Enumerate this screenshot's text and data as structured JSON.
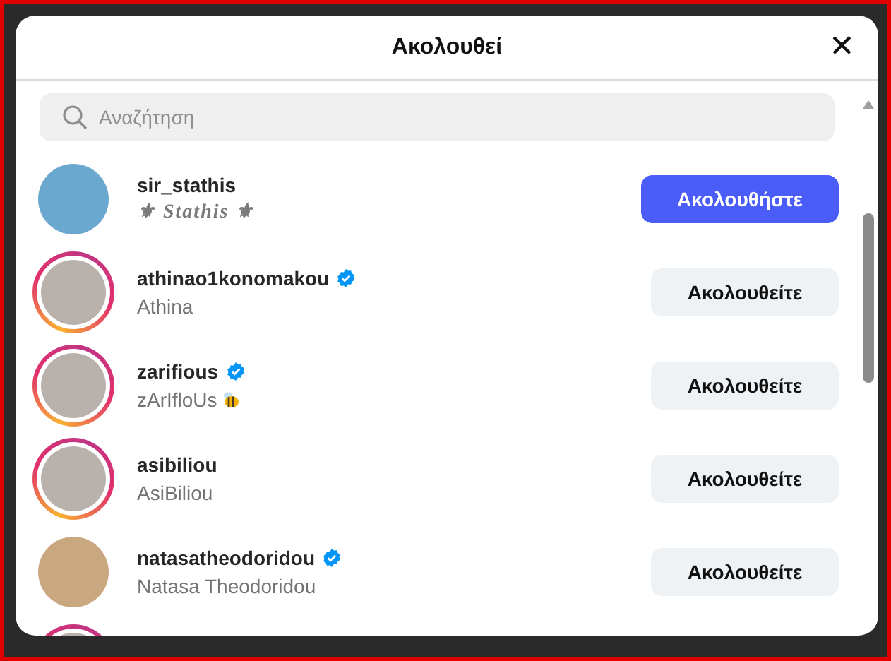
{
  "dialog": {
    "title": "Ακολουθεί",
    "close": "✕"
  },
  "search": {
    "placeholder": "Αναζήτηση"
  },
  "users": [
    {
      "username": "sir_stathis",
      "name": "⚜ Stathis ⚜",
      "fancy_name": true,
      "verified": false,
      "story_ring": false,
      "following": false,
      "button": "Ακολουθήστε"
    },
    {
      "username": "athinao1konomakou",
      "name": "Athina",
      "verified": true,
      "story_ring": true,
      "following": true,
      "button": "Ακολουθείτε"
    },
    {
      "username": "zarifious",
      "name": "zArIfloUs",
      "bee_emoji": true,
      "verified": true,
      "story_ring": true,
      "following": true,
      "button": "Ακολουθείτε"
    },
    {
      "username": "asibiliou",
      "name": "AsiBiliou",
      "verified": false,
      "story_ring": true,
      "following": true,
      "button": "Ακολουθείτε"
    },
    {
      "username": "natasatheodoridou",
      "name": "Natasa Theodoridou",
      "verified": true,
      "story_ring": false,
      "following": true,
      "button": "Ακολουθείτε"
    },
    {
      "story_ring": true
    }
  ]
}
